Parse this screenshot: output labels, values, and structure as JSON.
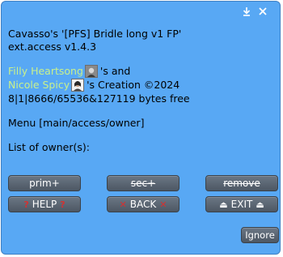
{
  "dialog": {
    "lines": [
      "Cavasso's '[PFS] Bridle long v1 FP'",
      "ext.access v1.4.3"
    ],
    "creators": {
      "first_name": "Filly Heartsong",
      "and_text": "'s and",
      "second_name": "Nicole Spicy",
      "creation_text": "'s Creation ©2024"
    },
    "bytes_line": "8|1|8666/65536&127119 bytes free",
    "menu_line": "Menu [main/access/owner]",
    "owners_line": "List of owner(s):"
  },
  "buttons": {
    "row1": [
      "prim+",
      "sec+",
      "remove"
    ],
    "help": "HELP",
    "back": "BACK",
    "exit": "EXIT",
    "ignore": "Ignore"
  },
  "icons": {
    "question": "?",
    "cross": "✕",
    "eject": "⏏"
  },
  "colors": {
    "dialog_bg": "#58a8f4",
    "name_link": "#c8f08c",
    "button_bg": "#5a6470"
  }
}
